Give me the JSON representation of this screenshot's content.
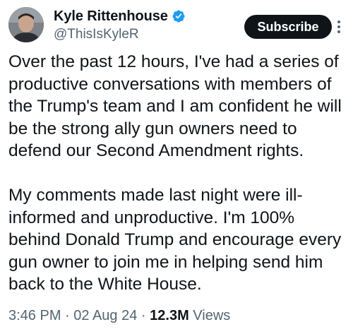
{
  "author": {
    "display_name": "Kyle Rittenhouse",
    "handle": "@ThisIsKyleR",
    "verified": true,
    "verified_icon": "verified-badge-icon",
    "verified_color": "#1d9bf0"
  },
  "actions": {
    "subscribe_label": "Subscribe",
    "more_icon": "more-options-icon"
  },
  "tweet": {
    "paragraphs": [
      "Over the past 12 hours, I've had a series of productive conversations with members of the Trump's team and I am confident he will be the strong ally gun owners need to defend our Second Amendment rights.",
      "My comments made last night were ill-informed and unproductive. I'm 100% behind Donald Trump and encourage every gun owner to join me in helping send him back to the White House."
    ]
  },
  "meta": {
    "time": "3:46 PM",
    "separator": " · ",
    "date": "02 Aug 24",
    "views_count": "12.3M",
    "views_label": " Views"
  },
  "colors": {
    "text_primary": "#0f1419",
    "text_secondary": "#536471",
    "button_bg": "#0f1419",
    "button_text": "#ffffff"
  }
}
